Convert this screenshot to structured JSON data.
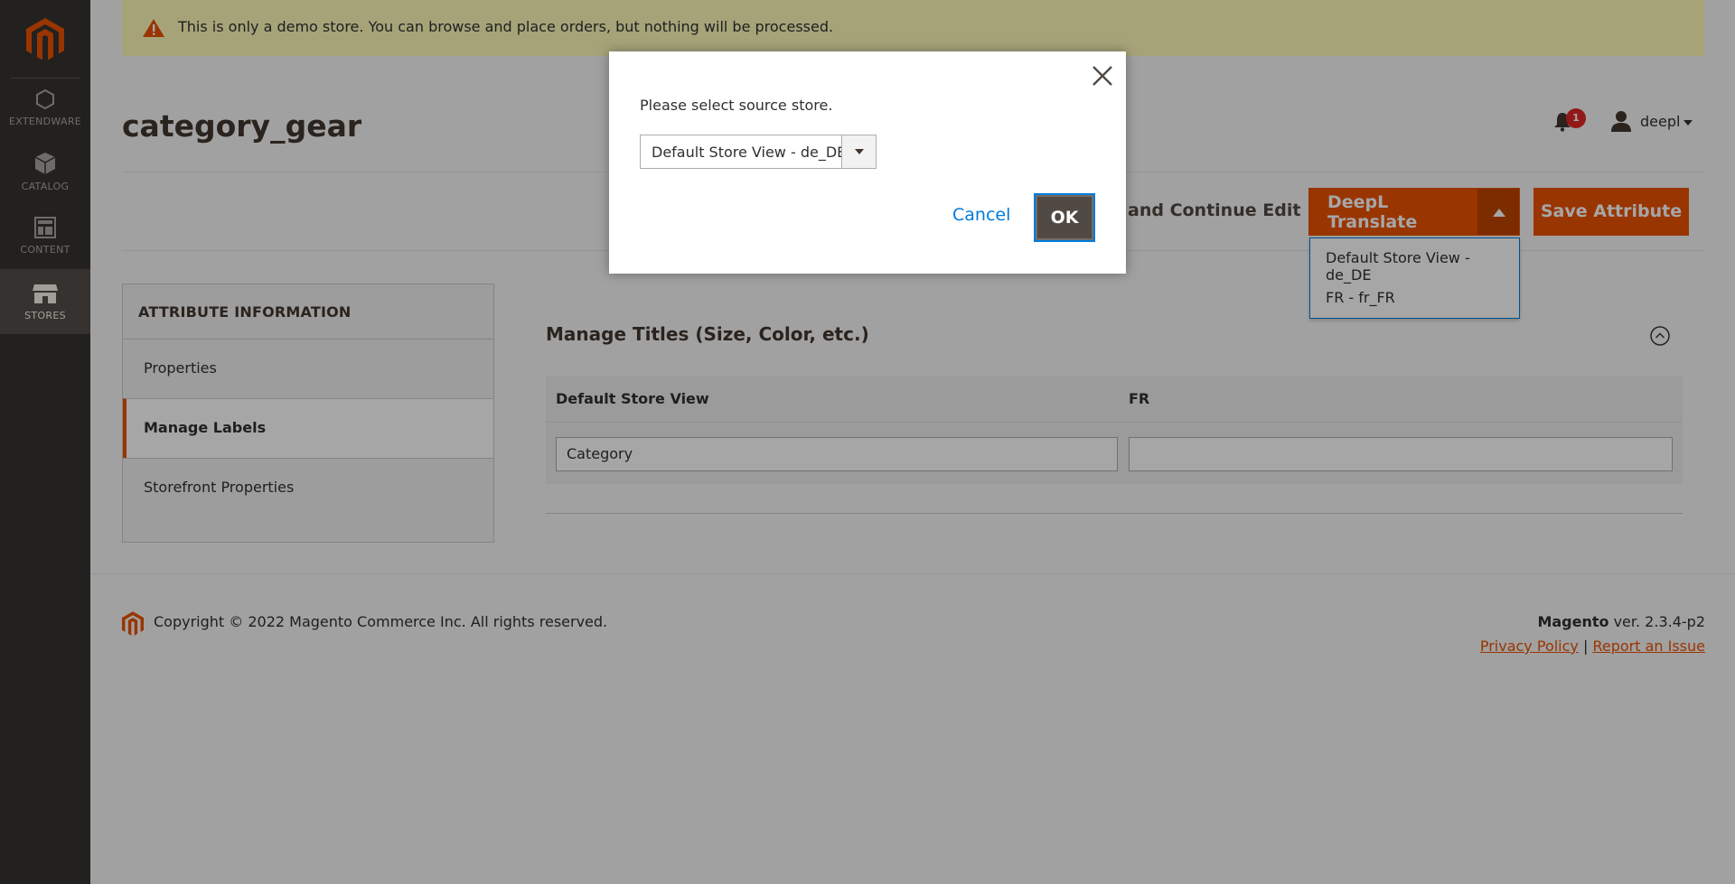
{
  "notice": {
    "text": "This is only a demo store. You can browse and place orders, but nothing will be processed."
  },
  "sidebar": {
    "items": [
      {
        "label": "EXTENDWARE",
        "icon": "hexagon-icon"
      },
      {
        "label": "CATALOG",
        "icon": "box-icon"
      },
      {
        "label": "CONTENT",
        "icon": "layout-icon"
      },
      {
        "label": "STORES",
        "icon": "store-icon"
      }
    ],
    "active": "STORES"
  },
  "header": {
    "title": "category_gear",
    "notification_count": "1",
    "user": "deepl"
  },
  "actions": {
    "save_continue": "and Continue Edit",
    "deepl_translate": "DeepL Translate",
    "save_attribute": "Save Attribute",
    "deepl_menu": [
      "Default Store View - de_DE",
      "FR - fr_FR"
    ]
  },
  "tabs": {
    "title": "ATTRIBUTE INFORMATION",
    "items": [
      "Properties",
      "Manage Labels",
      "Storefront Properties"
    ],
    "active": "Manage Labels"
  },
  "manage_titles": {
    "heading": "Manage Titles (Size, Color, etc.)",
    "columns": [
      "Default Store View",
      "FR"
    ],
    "values": [
      "Category",
      ""
    ]
  },
  "footer": {
    "copyright": "Copyright © 2022 Magento Commerce Inc. All rights reserved.",
    "brand": "Magento",
    "version": " ver. 2.3.4-p2",
    "privacy": "Privacy Policy",
    "separator": "|",
    "report": "Report an Issue"
  },
  "modal": {
    "message": "Please select source store.",
    "selected_store": "Default Store View - de_DE",
    "cancel": "Cancel",
    "ok": "OK"
  },
  "colors": {
    "accent": "#eb5202",
    "sidebar": "#373330",
    "link": "#007bdb",
    "notice_bg": "#fffbbb"
  }
}
